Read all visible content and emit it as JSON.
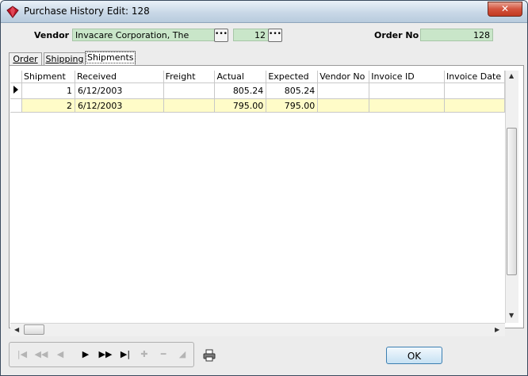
{
  "window": {
    "title": "Purchase History Edit: 128",
    "close_label": "✕"
  },
  "header": {
    "vendor_label": "Vendor",
    "vendor_name": "Invacare Corporation, The",
    "vendor_no": "12",
    "order_label": "Order No",
    "order_no": "128",
    "ellipsis": "•••"
  },
  "tabs": [
    {
      "label": "Order"
    },
    {
      "label": "Shipping"
    },
    {
      "label": "Shipments"
    }
  ],
  "grid": {
    "columns": [
      "Shipment",
      "Received",
      "Freight",
      "Actual",
      "Expected",
      "Vendor No",
      "Invoice ID",
      "Invoice Date"
    ],
    "rows": [
      {
        "shipment": "1",
        "received": "6/12/2003",
        "freight": "",
        "actual": "805.24",
        "expected": "805.24",
        "vendor_no": "",
        "invoice_id": "",
        "invoice_date": ""
      },
      {
        "shipment": "2",
        "received": "6/12/2003",
        "freight": "",
        "actual": "795.00",
        "expected": "795.00",
        "vendor_no": "",
        "invoice_id": "",
        "invoice_date": ""
      }
    ]
  },
  "footer": {
    "ok_label": "OK"
  },
  "colors": {
    "field_bg": "#c9e6c9",
    "alt_row_bg": "#fffcc8",
    "close_red": "#c23a22"
  }
}
